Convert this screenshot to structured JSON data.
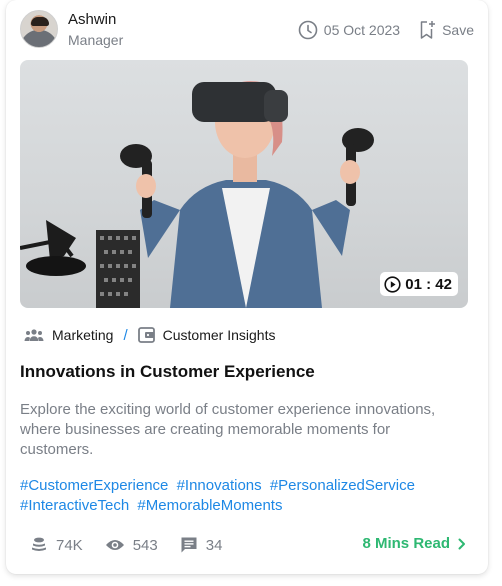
{
  "author": {
    "name": "Ashwin",
    "role": "Manager"
  },
  "meta": {
    "date": "05 Oct 2023",
    "save_label": "Save"
  },
  "video": {
    "duration": "01 : 42"
  },
  "breadcrumb": {
    "category": "Marketing",
    "subcategory": "Customer Insights",
    "separator": "/"
  },
  "post": {
    "title": "Innovations in Customer Experience",
    "description": "Explore the exciting world of customer experience innovations, where businesses are creating memorable moments for customers.",
    "tags": [
      "#CustomerExperience",
      "#Innovations",
      "#PersonalizedService",
      "#InteractiveTech",
      "#MemorableMoments"
    ]
  },
  "stats": {
    "coins": "74K",
    "views": "543",
    "comments": "34"
  },
  "read_more": {
    "label": "8 Mins Read"
  },
  "colors": {
    "link": "#1e88e5",
    "accent_green": "#2eb872",
    "muted": "#7a7f87"
  },
  "icons": [
    "clock-icon",
    "bookmark-add-icon",
    "play-circle-icon",
    "group-icon",
    "wallet-icon",
    "coins-icon",
    "eye-icon",
    "comment-icon",
    "chevron-right-icon"
  ]
}
